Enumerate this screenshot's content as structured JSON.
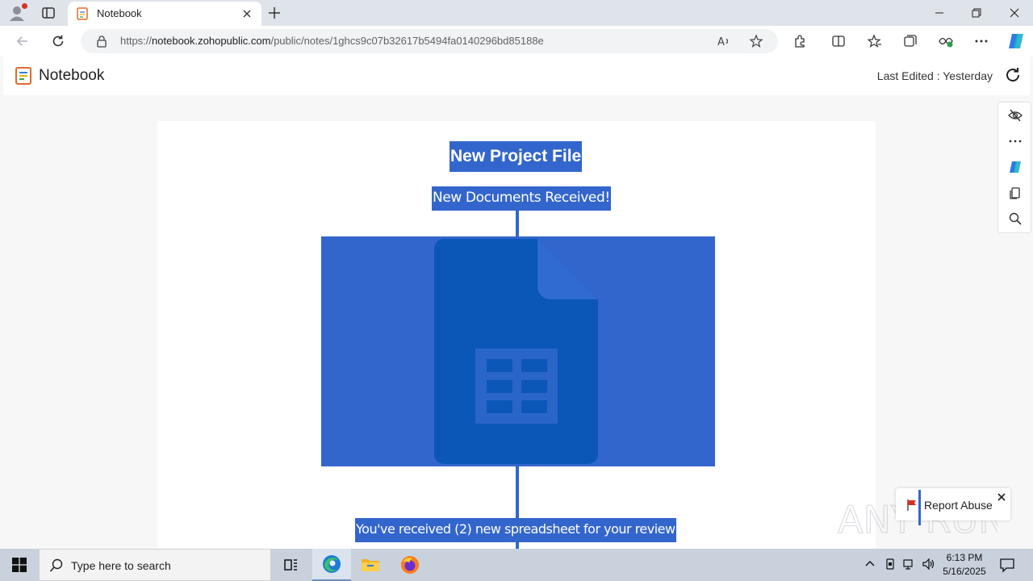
{
  "browser": {
    "tab_title": "Notebook",
    "url_prefix": "https://",
    "url_domain": "notebook.zohopublic.com",
    "url_path": "/public/notes/1ghcs9c07b32617b5494fa0140296bd85188e"
  },
  "app": {
    "name": "Notebook",
    "last_edited": "Last Edited : Yesterday"
  },
  "note": {
    "title": "New Project File",
    "subtitle": "New Documents Received!",
    "image_icon": "google-sheets-icon",
    "footer_text": "You've received (2) new spreadsheet for your review"
  },
  "report_abuse": {
    "label": "Report Abuse"
  },
  "watermark": {
    "text": "ANY RUN"
  },
  "taskbar": {
    "search_placeholder": "Type here to search",
    "time": "6:13 PM",
    "date": "5/16/2025"
  },
  "colors": {
    "accent": "#3366cc",
    "sheet_icon": "#0b57b8"
  }
}
